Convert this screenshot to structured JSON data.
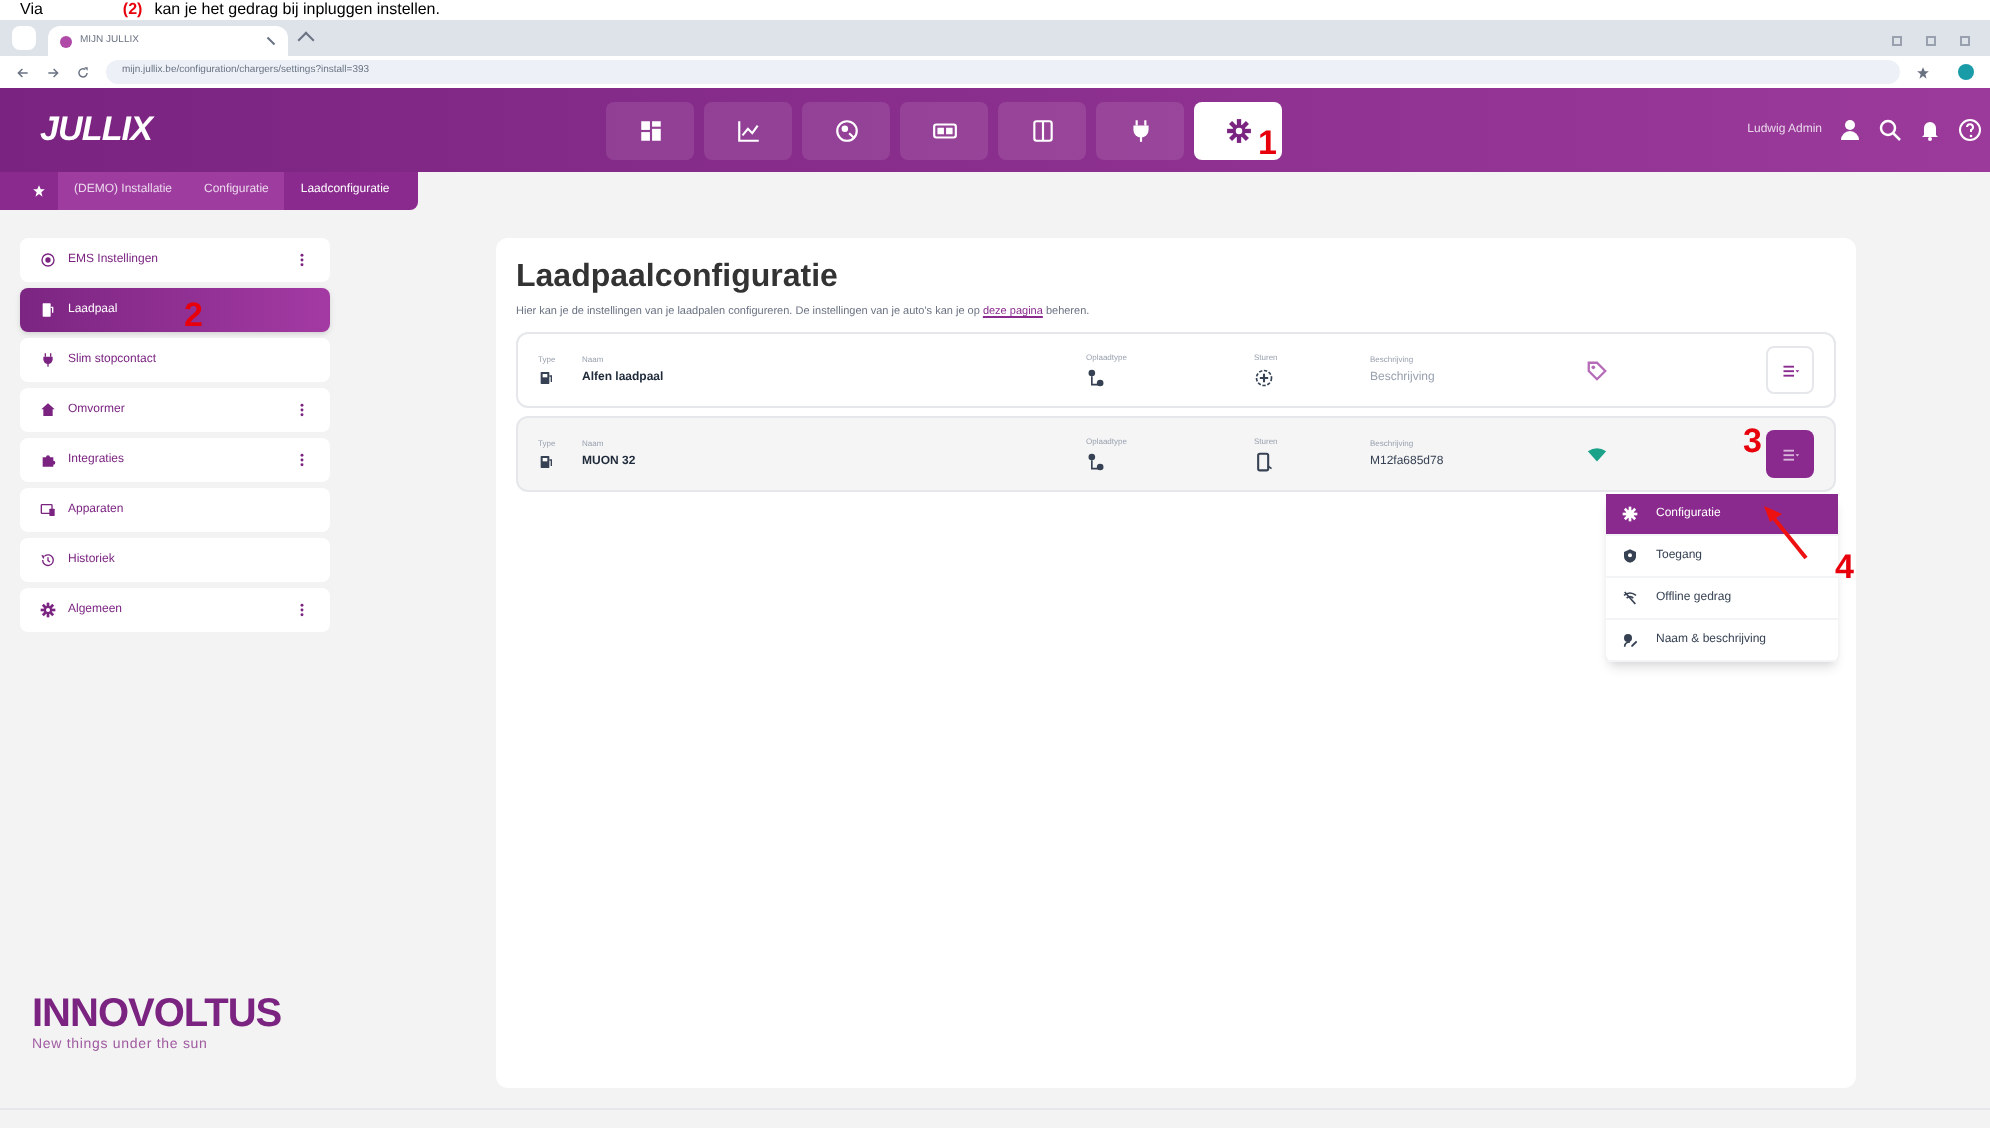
{
  "caption": {
    "prefix": "Via",
    "marker": "(2)",
    "suffix": "kan je het gedrag bij inpluggen instellen."
  },
  "browser": {
    "tab_title": "MIJN JULLIX",
    "url": "mijn.jullix.be/configuration/chargers/settings?install=393"
  },
  "header": {
    "logo": "JULLIX",
    "nav": [
      {
        "selected": false
      },
      {
        "selected": false
      },
      {
        "selected": false
      },
      {
        "selected": false
      },
      {
        "selected": false
      },
      {
        "selected": false
      },
      {
        "selected": true,
        "annotation": "1"
      }
    ],
    "user": "Ludwig Admin"
  },
  "breadcrumb": [
    "(DEMO) Installatie",
    "Configuratie",
    "Laadconfiguratie"
  ],
  "sidebar": {
    "items": [
      {
        "label": "EMS Instellingen",
        "menu": true,
        "selected": false
      },
      {
        "label": "Laadpaal",
        "menu": false,
        "selected": true,
        "annotation": "2"
      },
      {
        "label": "Slim stopcontact",
        "menu": false,
        "selected": false
      },
      {
        "label": "Omvormer",
        "menu": true,
        "selected": false
      },
      {
        "label": "Integraties",
        "menu": true,
        "selected": false
      },
      {
        "label": "Apparaten",
        "menu": false,
        "selected": false
      },
      {
        "label": "Historiek",
        "menu": false,
        "selected": false
      },
      {
        "label": "Algemeen",
        "menu": true,
        "selected": false
      }
    ],
    "brand": "INNOVOLTUS",
    "tagline": "New things under the sun"
  },
  "content": {
    "title": "Laadpaalconfiguratie",
    "intro_before": "Hier kan je de instellingen van je laadpalen configureren. De instellingen van je auto's kan je op",
    "intro_link": "deze pagina",
    "intro_after": "beheren.",
    "chargers": [
      {
        "column_labels": [
          "Type",
          "Naam",
          "Oplaadtype",
          "Sturen",
          "Beschrijving"
        ],
        "name": "Alfen laadpaal",
        "description": "Beschrijving",
        "description_placeholder": true,
        "selected": false
      },
      {
        "column_labels": [
          "Type",
          "Naam",
          "Oplaadtype",
          "Sturen",
          "Beschrijving"
        ],
        "name": "MUON 32",
        "description": "M12fa685d78",
        "description_placeholder": false,
        "selected": true,
        "annotation": "3"
      }
    ],
    "menu": {
      "items": [
        {
          "label": "Configuratie",
          "selected": true
        },
        {
          "label": "Toegang",
          "selected": false
        },
        {
          "label": "Offline gedrag",
          "selected": false
        },
        {
          "label": "Naam & beschrijving",
          "selected": false
        }
      ],
      "annotation": "4"
    }
  }
}
